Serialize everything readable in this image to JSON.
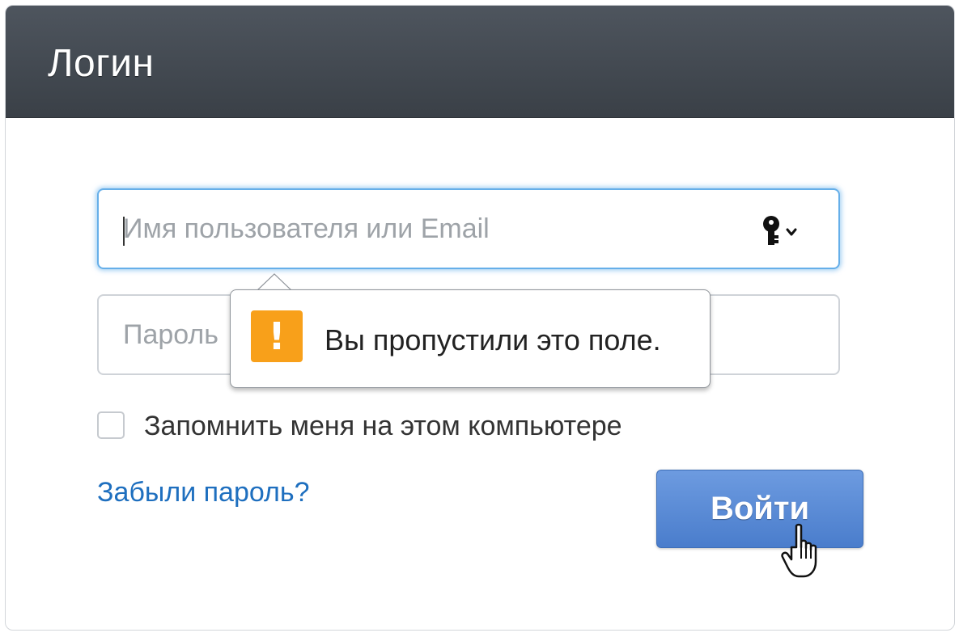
{
  "header": {
    "title": "Логин"
  },
  "form": {
    "username_placeholder": "Имя пользователя или Email",
    "password_placeholder": "Пароль",
    "remember_label": "Запомнить меня на этом компьютере",
    "forgot_link": "Забыли пароль?",
    "submit_label": "Войти"
  },
  "validation": {
    "message": "Вы пропустили это поле.",
    "icon": "warning-icon",
    "icon_color": "#f8a01a"
  },
  "icons": {
    "key_dropdown": "key-dropdown-icon",
    "cursor": "hand-pointer-cursor"
  },
  "colors": {
    "header_bg": "#43494f",
    "focus_border": "#66afe9",
    "link": "#1e6fbf",
    "button": "#5a8ad6"
  }
}
